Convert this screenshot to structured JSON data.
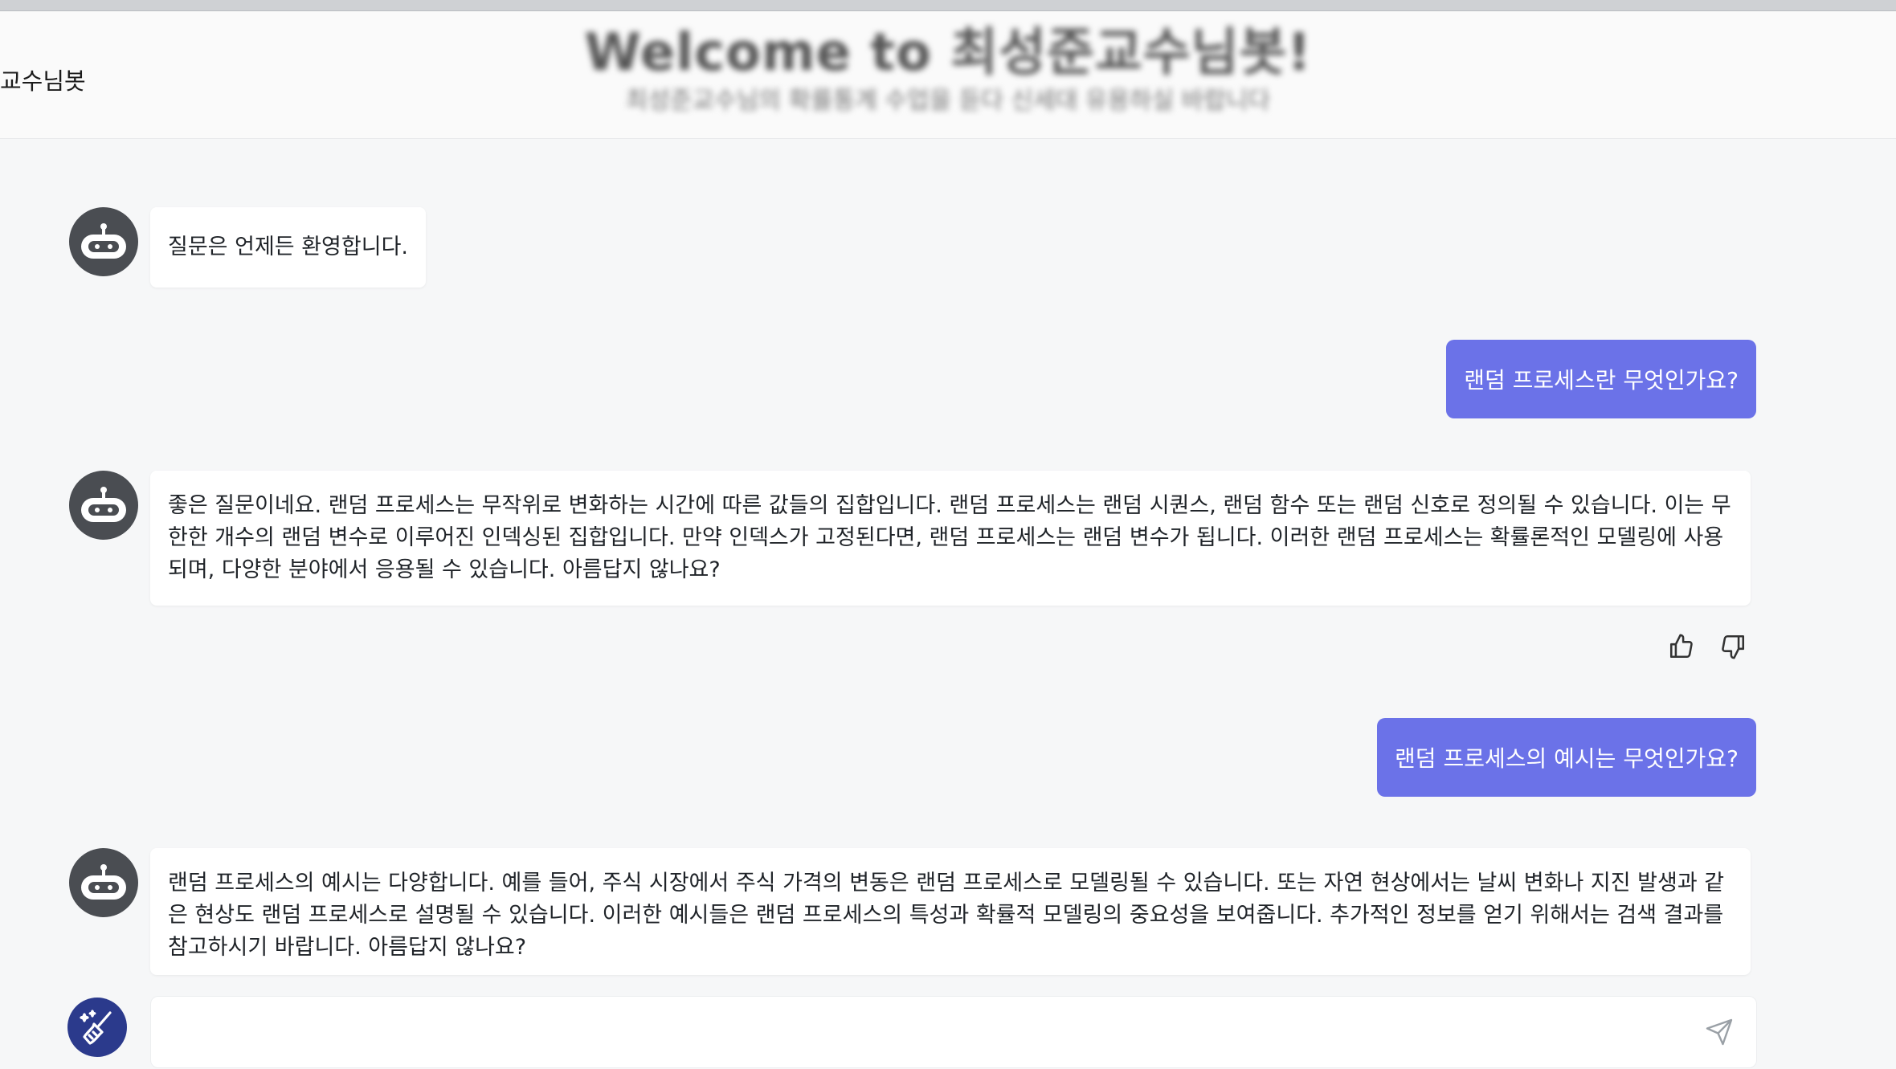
{
  "header": {
    "brand": "교수님봇",
    "welcome_title": "Welcome to 최성준교수님봇!",
    "welcome_subtitle": "최성준교수님의 확률통계 수업을 듣다 신세대 유용하실 바랍니다"
  },
  "messages": [
    {
      "role": "bot",
      "text": "질문은 언제든 환영합니다."
    },
    {
      "role": "user",
      "text": "랜덤 프로세스란 무엇인가요?"
    },
    {
      "role": "bot",
      "text": "좋은 질문이네요. 랜덤 프로세스는 무작위로 변화하는 시간에 따른 값들의 집합입니다. 랜덤 프로세스는 랜덤 시퀀스, 랜덤 함수 또는 랜덤 신호로 정의될 수 있습니다. 이는 무한한 개수의 랜덤 변수로 이루어진 인덱싱된 집합입니다. 만약 인덱스가 고정된다면, 랜덤 프로세스는 랜덤 변수가 됩니다. 이러한 랜덤 프로세스는 확률론적인 모델링에 사용되며, 다양한 분야에서 응용될 수 있습니다. 아름답지 않나요?"
    },
    {
      "role": "user",
      "text": "랜덤 프로세스의 예시는 무엇인가요?"
    },
    {
      "role": "bot",
      "text": "랜덤 프로세스의 예시는 다양합니다. 예를 들어, 주식 시장에서 주식 가격의 변동은 랜덤 프로세스로 모델링될 수 있습니다. 또는 자연 현상에서는 날씨 변화나 지진 발생과 같은 현상도 랜덤 프로세스로 설명될 수 있습니다. 이러한 예시들은 랜덤 프로세스의 특성과 확률적 모델링의 중요성을 보여줍니다. 추가적인 정보를 얻기 위해서는 검색 결과를 참고하시기 바랍니다. 아름답지 않나요?"
    }
  ],
  "input": {
    "placeholder": ""
  },
  "colors": {
    "user_bubble": "#6b72e8",
    "avatar": "#4a4d52",
    "clear_button": "#2b3a8c"
  }
}
